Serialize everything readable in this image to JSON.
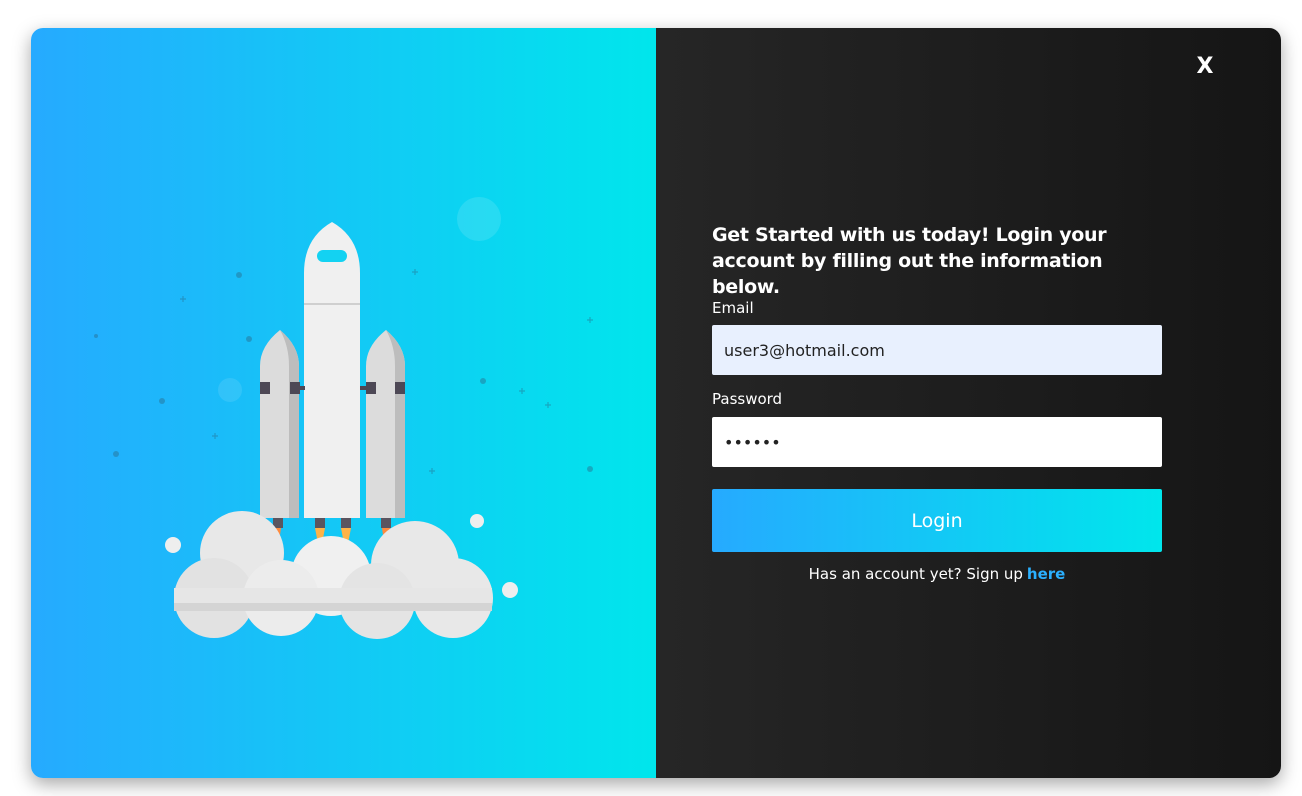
{
  "close_label": "X",
  "form": {
    "heading": "Get Started with us today! Login your account by filling out the information below.",
    "email_label": "Email",
    "email_value": "user3@hotmail.com",
    "password_label": "Password",
    "password_value": "••••••",
    "login_label": "Login",
    "signup_text": "Has an account yet? Sign up",
    "signup_link": "here"
  },
  "colors": {
    "gradient_start": "#26aaff",
    "gradient_end": "#00e6ec",
    "panel_dark": "#1e1e1e",
    "link": "#2bb0ff",
    "email_fill": "#e8f0fe"
  },
  "illustration": {
    "icon": "rocket-launch-illustration"
  }
}
